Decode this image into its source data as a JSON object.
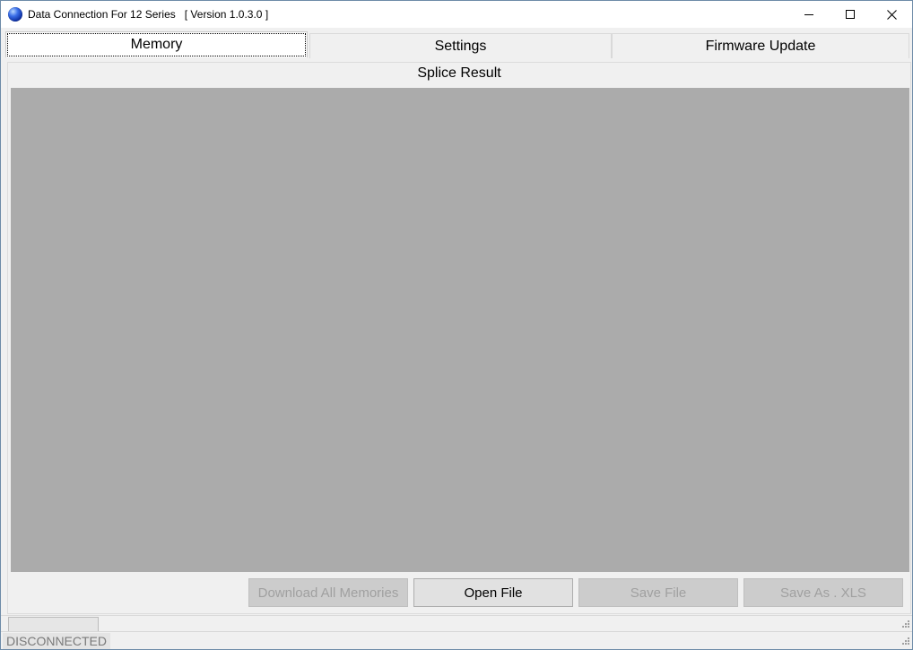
{
  "window": {
    "title": "Data Connection For 12 Series   [ Version 1.0.3.0 ]",
    "icon": "blue-globe-icon"
  },
  "window_controls": {
    "minimize_icon": "minimize-icon",
    "maximize_icon": "maximize-icon",
    "close_icon": "close-icon"
  },
  "tabs": [
    {
      "label": "Memory",
      "active": true
    },
    {
      "label": "Settings",
      "active": false
    },
    {
      "label": "Firmware Update",
      "active": false
    }
  ],
  "memory_page": {
    "section_title": "Splice Result",
    "buttons": [
      {
        "label": "Download All Memories",
        "enabled": false
      },
      {
        "label": "Open File",
        "enabled": true
      },
      {
        "label": "Save File",
        "enabled": false
      },
      {
        "label": "Save As . XLS",
        "enabled": false
      }
    ]
  },
  "status": {
    "connection": "DISCONNECTED"
  },
  "colors": {
    "grid_background": "#ababab",
    "window_border": "#6e8ba8",
    "disabled_text": "#a0a0a0"
  }
}
